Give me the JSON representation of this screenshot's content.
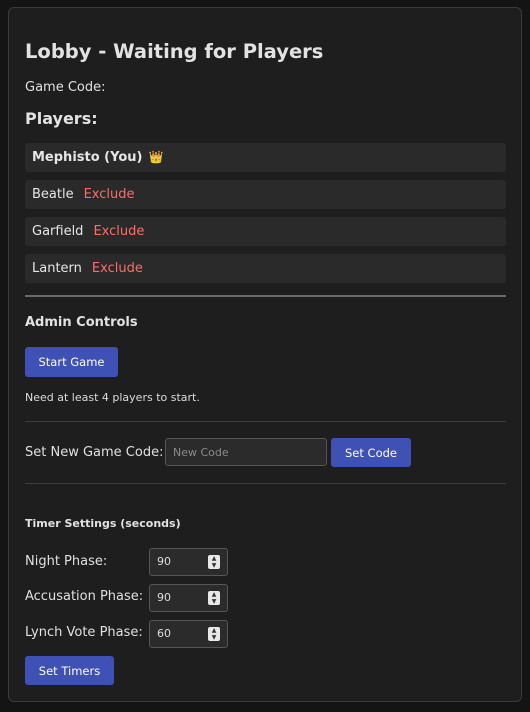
{
  "lobby": {
    "title": "Lobby - Waiting for Players",
    "game_code_label": "Game Code:",
    "players_heading": "Players:",
    "me": {
      "name": "Mephisto (You)",
      "crown": "👑"
    },
    "players": [
      {
        "name": "Beatle",
        "action": "Exclude"
      },
      {
        "name": "Garfield",
        "action": "Exclude"
      },
      {
        "name": "Lantern",
        "action": "Exclude"
      }
    ]
  },
  "admin": {
    "heading": "Admin Controls",
    "start_button": "Start Game",
    "need_players": "Need at least 4 players to start.",
    "new_code_label": "Set New Game Code:",
    "new_code_placeholder": "New Code",
    "set_code_button": "Set Code"
  },
  "timers": {
    "heading": "Timer Settings (seconds)",
    "rows": [
      {
        "label": "Night Phase:",
        "value": "90"
      },
      {
        "label": "Accusation Phase:",
        "value": "90"
      },
      {
        "label": "Lynch Vote Phase:",
        "value": "60"
      }
    ],
    "set_button": "Set Timers"
  },
  "colors": {
    "accent": "#3f51b5",
    "danger": "#ff6b6b",
    "background": "#1e1e1e"
  }
}
